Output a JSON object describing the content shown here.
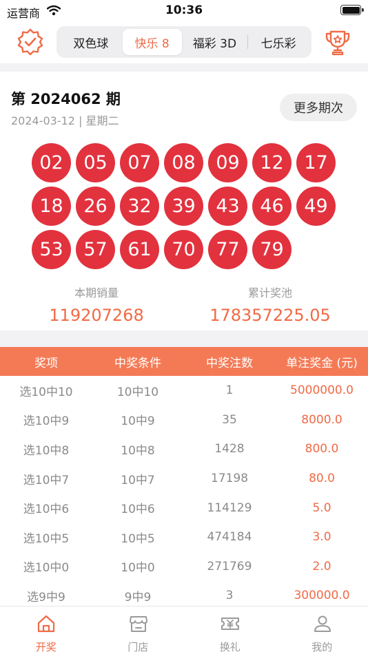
{
  "status_bar": {
    "carrier": "运营商",
    "time": "10:36"
  },
  "header": {
    "left_icon": "verified-badge-icon",
    "right_icon": "trophy-icon",
    "tabs": [
      {
        "label": "双色球",
        "active": false
      },
      {
        "label": "快乐 8",
        "active": true
      },
      {
        "label": "福彩 3D",
        "active": false
      },
      {
        "label": "七乐彩",
        "active": false
      }
    ]
  },
  "draw": {
    "issue": "第 2024062 期",
    "date": "2024-03-12  |  星期二",
    "more_label": "更多期次",
    "numbers": [
      "02",
      "05",
      "07",
      "08",
      "09",
      "12",
      "17",
      "18",
      "26",
      "32",
      "39",
      "43",
      "46",
      "49",
      "53",
      "57",
      "61",
      "70",
      "77",
      "79"
    ],
    "sales_label": "本期销量",
    "sales_value": "119207268",
    "pool_label": "累计奖池",
    "pool_value": "178357225.05"
  },
  "prize_table": {
    "headers": [
      "奖项",
      "中奖条件",
      "中奖注数",
      "单注奖金 (元)"
    ],
    "rows": [
      [
        "选10中10",
        "10中10",
        "1",
        "5000000.0"
      ],
      [
        "选10中9",
        "10中9",
        "35",
        "8000.0"
      ],
      [
        "选10中8",
        "10中8",
        "1428",
        "800.0"
      ],
      [
        "选10中7",
        "10中7",
        "17198",
        "80.0"
      ],
      [
        "选10中6",
        "10中6",
        "114129",
        "5.0"
      ],
      [
        "选10中5",
        "10中5",
        "474184",
        "3.0"
      ],
      [
        "选10中0",
        "10中0",
        "271769",
        "2.0"
      ],
      [
        "选9中9",
        "9中9",
        "3",
        "300000.0"
      ]
    ]
  },
  "tabbar": [
    {
      "label": "开奖",
      "icon": "home-icon",
      "active": true
    },
    {
      "label": "门店",
      "icon": "store-icon",
      "active": false
    },
    {
      "label": "换礼",
      "icon": "gift-ticket-icon",
      "active": false
    },
    {
      "label": "我的",
      "icon": "user-icon",
      "active": false
    }
  ],
  "colors": {
    "accent": "#f06a45",
    "ball": "#e2323e",
    "table_header": "#f47a55"
  }
}
